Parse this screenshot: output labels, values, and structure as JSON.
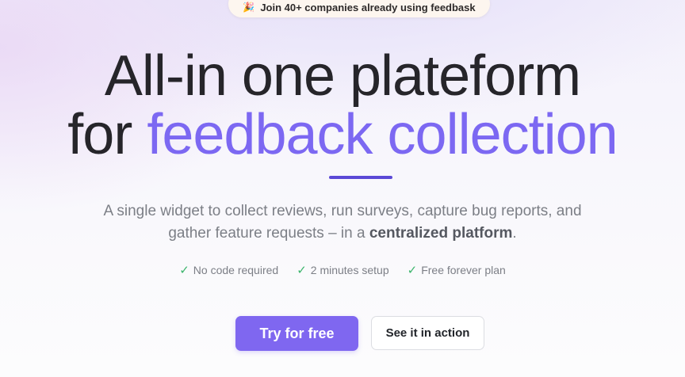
{
  "badge": {
    "icon": "party-popper-icon",
    "text": "Join 40+ companies already using feedbask"
  },
  "hero": {
    "line1": "All-in one plateform",
    "line2_plain": "for",
    "line2_accent": "feedback collection",
    "accent_color": "#7c68f2",
    "divider_color": "#5b49d6"
  },
  "subtitle": {
    "line1": "A single widget to collect reviews, run surveys, capture bug reports, and",
    "line2_prefix": "gather feature requests – in a",
    "line2_bold": "centralized platform",
    "line2_suffix": "."
  },
  "features": [
    {
      "check": "✓",
      "label": "No code required"
    },
    {
      "check": "✓",
      "label": "2 minutes setup"
    },
    {
      "check": "✓",
      "label": "Free forever plan"
    }
  ],
  "cta": {
    "primary_label": "Try for free",
    "primary_color": "#7f67f0",
    "secondary_label": "See it in action"
  }
}
